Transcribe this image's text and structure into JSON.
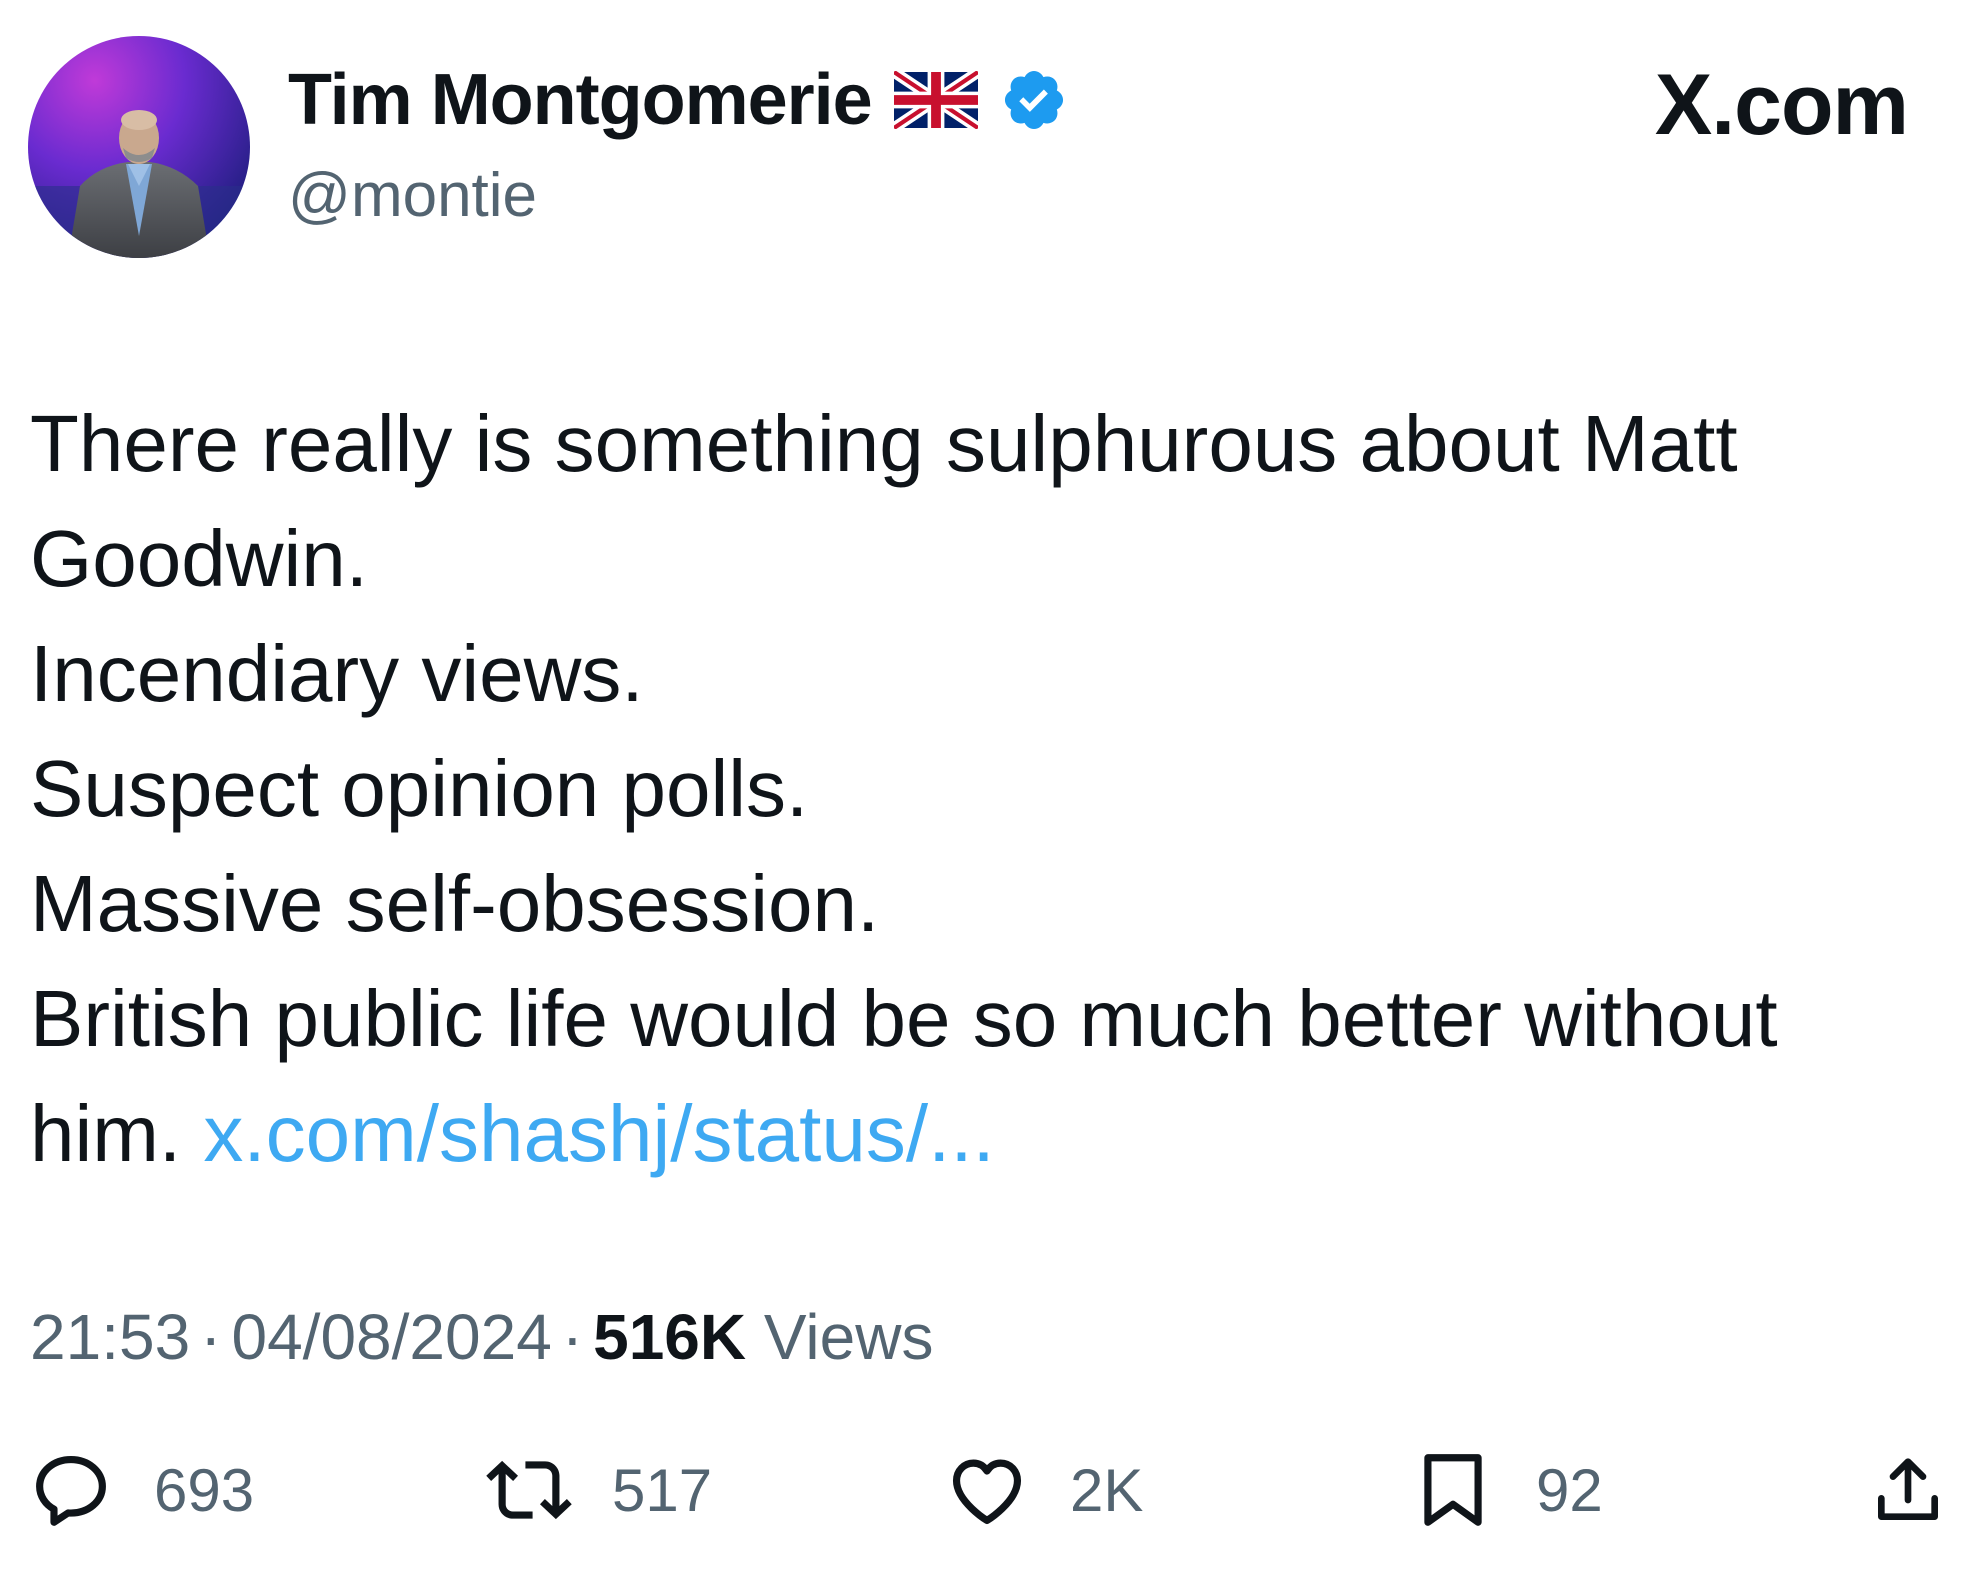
{
  "author": {
    "display_name": "Tim Montgomerie",
    "flag_icon": "uk-flag-icon",
    "verified_icon": "verified-badge-icon",
    "handle": "@montie"
  },
  "brand": "X.com",
  "tweet": {
    "lines": [
      "There really is something sulphurous about Matt",
      "Goodwin.",
      "Incendiary views.",
      "Suspect opinion polls.",
      "Massive self-obsession.",
      "British public life would be so much better without"
    ],
    "last_line_text": "him.",
    "link_text": "x.com/shashj/status/..."
  },
  "meta": {
    "time": "21:53",
    "separator": "·",
    "date": "04/08/2024",
    "views_count": "516K",
    "views_label": "Views"
  },
  "actions": {
    "reply": {
      "icon": "reply-icon",
      "count": "693"
    },
    "repost": {
      "icon": "repost-icon",
      "count": "517"
    },
    "like": {
      "icon": "heart-icon",
      "count": "2K"
    },
    "bookmark": {
      "icon": "bookmark-icon",
      "count": "92"
    },
    "share": {
      "icon": "share-icon"
    }
  },
  "colors": {
    "text": "#0f1419",
    "secondary": "#536471",
    "link": "#1d9bf0",
    "verified": "#1d9bf0"
  }
}
